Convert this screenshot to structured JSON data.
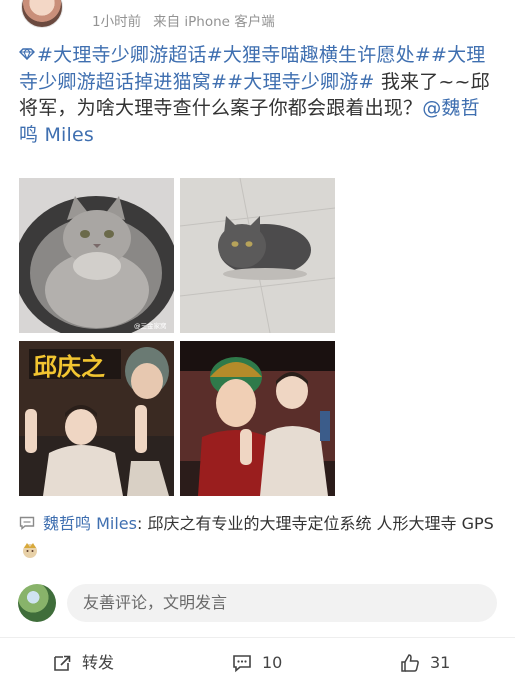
{
  "header": {
    "time": "1小时前",
    "source": "来自 iPhone 客户端"
  },
  "post": {
    "topic_1": "#大理寺少卿游超话",
    "topic_2": "#大狸寺喵趣横生许愿处#",
    "topic_3": "#大理寺少卿游超话掉进猫窝#",
    "topic_4": "#大理寺少卿游#",
    "text": " 我来了~~邱将军，为啥大理寺查什么案子你都会跟着出现？",
    "mention": "@魏哲鸣 Miles"
  },
  "images": [
    {
      "icon": "cat-photo-1",
      "watermark": "@三金家窝"
    },
    {
      "icon": "cat-photo-2"
    },
    {
      "icon": "poster-photo-1",
      "poster_text": "邱庆之"
    },
    {
      "icon": "poster-photo-2"
    }
  ],
  "comment_preview": {
    "author": "魏哲鸣 Miles",
    "text": ": 邱庆之有专业的大理寺定位系统 人形大理寺 GPS"
  },
  "reply": {
    "placeholder": "友善评论，文明发言"
  },
  "actions": {
    "repost_label": "转发",
    "comment_count": "10",
    "like_count": "31"
  },
  "colors": {
    "link": "#3f6fb0",
    "meta": "#939393",
    "input_bg": "#f2f2f2"
  }
}
